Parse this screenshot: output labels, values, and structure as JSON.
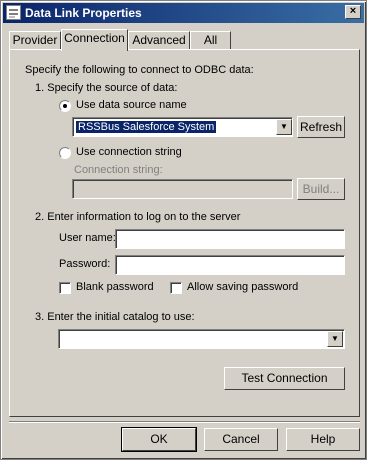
{
  "window": {
    "title": "Data Link Properties",
    "close_label": "×"
  },
  "tabs": [
    {
      "label": "Provider"
    },
    {
      "label": "Connection"
    },
    {
      "label": "Advanced"
    },
    {
      "label": "All"
    }
  ],
  "connection": {
    "intro": "Specify the following to connect to ODBC data:",
    "step1": "1. Specify the source of data:",
    "use_dsn_label": "Use data source name",
    "dsn_value": "RSSBus Salesforce System",
    "refresh_label": "Refresh",
    "use_conn_string_label": "Use connection string",
    "conn_string_label": "Connection string:",
    "conn_string_value": "",
    "build_label": "Build...",
    "step2": "2. Enter information to log on to the server",
    "user_name_label": "User name:",
    "user_name_value": "",
    "password_label": "Password:",
    "password_value": "",
    "blank_password_label": "Blank password",
    "allow_saving_label": "Allow saving password",
    "step3": "3. Enter the initial catalog to use:",
    "catalog_value": "",
    "test_connection_label": "Test Connection"
  },
  "footer": {
    "ok_label": "OK",
    "cancel_label": "Cancel",
    "help_label": "Help"
  }
}
